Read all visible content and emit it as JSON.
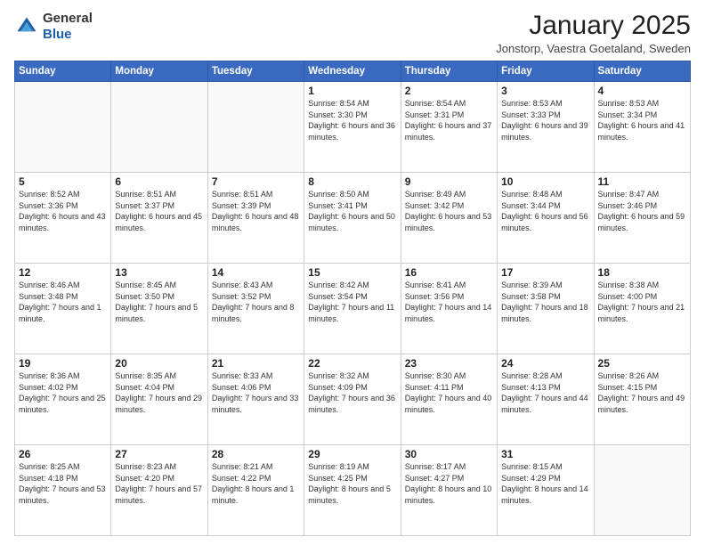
{
  "logo": {
    "general": "General",
    "blue": "Blue"
  },
  "header": {
    "month": "January 2025",
    "location": "Jonstorp, Vaestra Goetaland, Sweden"
  },
  "days_of_week": [
    "Sunday",
    "Monday",
    "Tuesday",
    "Wednesday",
    "Thursday",
    "Friday",
    "Saturday"
  ],
  "weeks": [
    [
      {
        "day": "",
        "info": ""
      },
      {
        "day": "",
        "info": ""
      },
      {
        "day": "",
        "info": ""
      },
      {
        "day": "1",
        "info": "Sunrise: 8:54 AM\nSunset: 3:30 PM\nDaylight: 6 hours and 36 minutes."
      },
      {
        "day": "2",
        "info": "Sunrise: 8:54 AM\nSunset: 3:31 PM\nDaylight: 6 hours and 37 minutes."
      },
      {
        "day": "3",
        "info": "Sunrise: 8:53 AM\nSunset: 3:33 PM\nDaylight: 6 hours and 39 minutes."
      },
      {
        "day": "4",
        "info": "Sunrise: 8:53 AM\nSunset: 3:34 PM\nDaylight: 6 hours and 41 minutes."
      }
    ],
    [
      {
        "day": "5",
        "info": "Sunrise: 8:52 AM\nSunset: 3:36 PM\nDaylight: 6 hours and 43 minutes."
      },
      {
        "day": "6",
        "info": "Sunrise: 8:51 AM\nSunset: 3:37 PM\nDaylight: 6 hours and 45 minutes."
      },
      {
        "day": "7",
        "info": "Sunrise: 8:51 AM\nSunset: 3:39 PM\nDaylight: 6 hours and 48 minutes."
      },
      {
        "day": "8",
        "info": "Sunrise: 8:50 AM\nSunset: 3:41 PM\nDaylight: 6 hours and 50 minutes."
      },
      {
        "day": "9",
        "info": "Sunrise: 8:49 AM\nSunset: 3:42 PM\nDaylight: 6 hours and 53 minutes."
      },
      {
        "day": "10",
        "info": "Sunrise: 8:48 AM\nSunset: 3:44 PM\nDaylight: 6 hours and 56 minutes."
      },
      {
        "day": "11",
        "info": "Sunrise: 8:47 AM\nSunset: 3:46 PM\nDaylight: 6 hours and 59 minutes."
      }
    ],
    [
      {
        "day": "12",
        "info": "Sunrise: 8:46 AM\nSunset: 3:48 PM\nDaylight: 7 hours and 1 minute."
      },
      {
        "day": "13",
        "info": "Sunrise: 8:45 AM\nSunset: 3:50 PM\nDaylight: 7 hours and 5 minutes."
      },
      {
        "day": "14",
        "info": "Sunrise: 8:43 AM\nSunset: 3:52 PM\nDaylight: 7 hours and 8 minutes."
      },
      {
        "day": "15",
        "info": "Sunrise: 8:42 AM\nSunset: 3:54 PM\nDaylight: 7 hours and 11 minutes."
      },
      {
        "day": "16",
        "info": "Sunrise: 8:41 AM\nSunset: 3:56 PM\nDaylight: 7 hours and 14 minutes."
      },
      {
        "day": "17",
        "info": "Sunrise: 8:39 AM\nSunset: 3:58 PM\nDaylight: 7 hours and 18 minutes."
      },
      {
        "day": "18",
        "info": "Sunrise: 8:38 AM\nSunset: 4:00 PM\nDaylight: 7 hours and 21 minutes."
      }
    ],
    [
      {
        "day": "19",
        "info": "Sunrise: 8:36 AM\nSunset: 4:02 PM\nDaylight: 7 hours and 25 minutes."
      },
      {
        "day": "20",
        "info": "Sunrise: 8:35 AM\nSunset: 4:04 PM\nDaylight: 7 hours and 29 minutes."
      },
      {
        "day": "21",
        "info": "Sunrise: 8:33 AM\nSunset: 4:06 PM\nDaylight: 7 hours and 33 minutes."
      },
      {
        "day": "22",
        "info": "Sunrise: 8:32 AM\nSunset: 4:09 PM\nDaylight: 7 hours and 36 minutes."
      },
      {
        "day": "23",
        "info": "Sunrise: 8:30 AM\nSunset: 4:11 PM\nDaylight: 7 hours and 40 minutes."
      },
      {
        "day": "24",
        "info": "Sunrise: 8:28 AM\nSunset: 4:13 PM\nDaylight: 7 hours and 44 minutes."
      },
      {
        "day": "25",
        "info": "Sunrise: 8:26 AM\nSunset: 4:15 PM\nDaylight: 7 hours and 49 minutes."
      }
    ],
    [
      {
        "day": "26",
        "info": "Sunrise: 8:25 AM\nSunset: 4:18 PM\nDaylight: 7 hours and 53 minutes."
      },
      {
        "day": "27",
        "info": "Sunrise: 8:23 AM\nSunset: 4:20 PM\nDaylight: 7 hours and 57 minutes."
      },
      {
        "day": "28",
        "info": "Sunrise: 8:21 AM\nSunset: 4:22 PM\nDaylight: 8 hours and 1 minute."
      },
      {
        "day": "29",
        "info": "Sunrise: 8:19 AM\nSunset: 4:25 PM\nDaylight: 8 hours and 5 minutes."
      },
      {
        "day": "30",
        "info": "Sunrise: 8:17 AM\nSunset: 4:27 PM\nDaylight: 8 hours and 10 minutes."
      },
      {
        "day": "31",
        "info": "Sunrise: 8:15 AM\nSunset: 4:29 PM\nDaylight: 8 hours and 14 minutes."
      },
      {
        "day": "",
        "info": ""
      }
    ]
  ]
}
